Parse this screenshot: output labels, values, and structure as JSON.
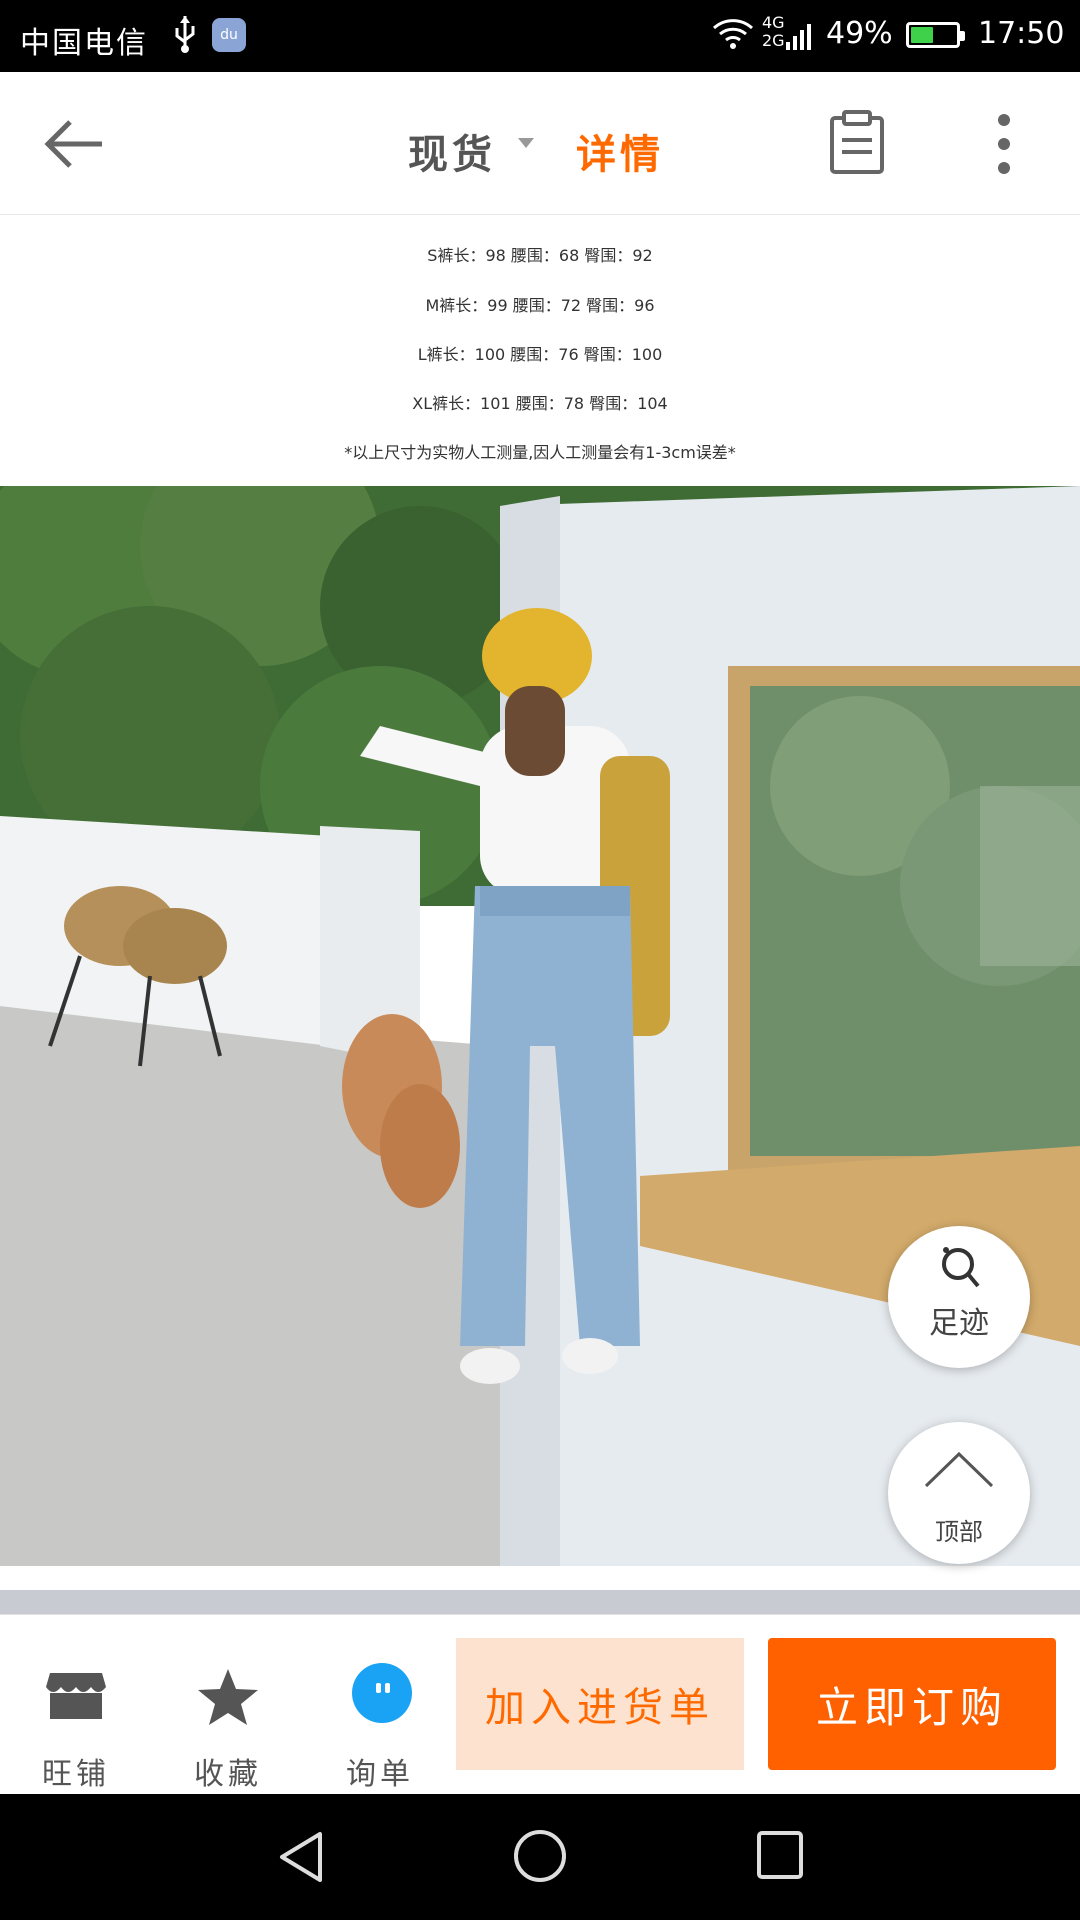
{
  "status_bar": {
    "carrier": "中国电信",
    "network": [
      "4G",
      "2G"
    ],
    "battery_percent": "49%",
    "battery_level": 0.49,
    "time": "17:50"
  },
  "header": {
    "tab_spot": "现货",
    "tab_detail": "详情",
    "active_tab": "详情",
    "accent_color": "#ff6a00"
  },
  "size_chart": {
    "rows": [
      "S裤长：98  腰围：68  臀围：92",
      "M裤长：99  腰围：72  臀围：96",
      "L裤长：100  腰围：76  臀围：100",
      "XL裤长：101  腰围：78  臀围：104"
    ],
    "note": "*以上尺寸为实物人工测量,因人工测量会有1-3cm误差*"
  },
  "floating": {
    "footprint_label": "足迹",
    "top_label": "顶部"
  },
  "bottom_bar": {
    "shop_label": "旺铺",
    "favorite_label": "收藏",
    "inquiry_label": "询单",
    "add_to_cart_label": "加入进货单",
    "buy_now_label": "立即订购",
    "icons": [
      "shop-icon",
      "star-icon",
      "chat-icon"
    ]
  }
}
